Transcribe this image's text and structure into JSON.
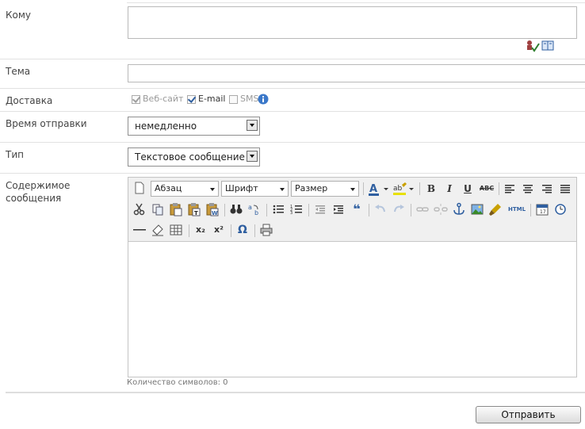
{
  "form": {
    "to": {
      "label": "Кому",
      "value": ""
    },
    "subject": {
      "label": "Тема",
      "value": ""
    },
    "delivery": {
      "label": "Доставка",
      "options": [
        {
          "label": "Веб-сайт",
          "checked": true,
          "disabled": true
        },
        {
          "label": "E-mail",
          "checked": true,
          "disabled": false
        },
        {
          "label": "SMS",
          "checked": false,
          "disabled": true
        }
      ]
    },
    "send_time": {
      "label": "Время отправки",
      "selected": "немедленно"
    },
    "type": {
      "label": "Тип",
      "selected": "Текстовое сообщение"
    },
    "content": {
      "label_line1": "Содержимое",
      "label_line2": "сообщения"
    }
  },
  "editor": {
    "toolbar": {
      "format_select": "Абзац",
      "font_select": "Шрифт",
      "size_select": "Размер",
      "icons": {
        "bold": "B",
        "italic": "I",
        "underline": "U",
        "strike": "ABC",
        "html": "HTML",
        "omega": "Ω",
        "subscript": "x₂",
        "superscript": "x²",
        "quote": "❝"
      }
    },
    "char_count_label": "Количество символов: 0"
  },
  "actions": {
    "send_label": "Отправить"
  },
  "colors": {
    "link_blue": "#2f5fa0",
    "border": "#b9b9b9",
    "separator": "#e2e2e2"
  }
}
